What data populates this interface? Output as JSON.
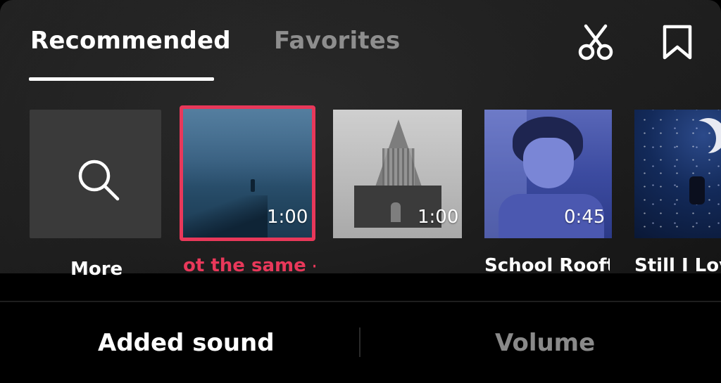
{
  "tabs": {
    "recommended": "Recommended",
    "favorites": "Favorites"
  },
  "toolbar": {
    "scissors_icon": "scissors-icon",
    "bookmark_icon": "bookmark-icon"
  },
  "more_tile": {
    "label": "More",
    "icon": "search-icon"
  },
  "tracks": [
    {
      "title": "ot the same -",
      "duration": "1:00",
      "selected": true
    },
    {
      "title": "",
      "duration": "1:00",
      "selected": false
    },
    {
      "title": "School Rooft",
      "duration": "0:45",
      "selected": false
    },
    {
      "title": "Still I Lov",
      "duration": "",
      "selected": false
    }
  ],
  "bottom": {
    "added_sound": "Added sound",
    "volume": "Volume"
  },
  "colors": {
    "accent": "#e8385a",
    "active_text": "#ffffff",
    "inactive_text": "#8e8e8e"
  }
}
